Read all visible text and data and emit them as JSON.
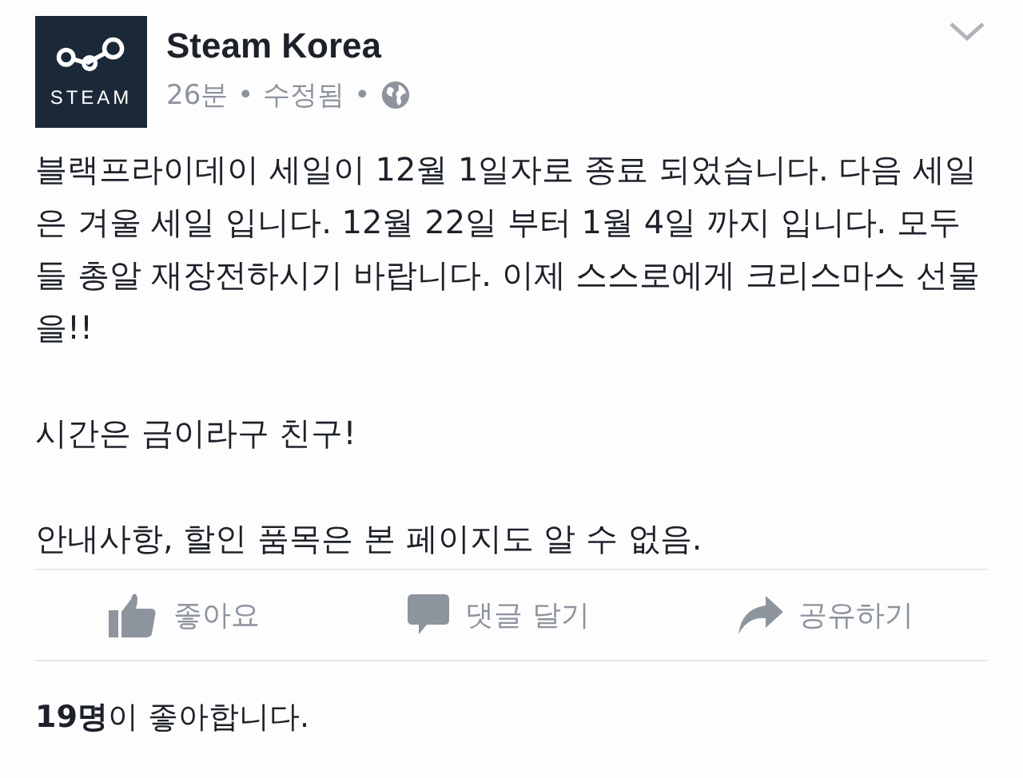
{
  "post": {
    "author": "Steam Korea",
    "logo_text": "STEAM",
    "time": "26분",
    "edited": "수정됨",
    "separator": "•",
    "paragraphs": [
      "블랙프라이데이 세일이 12월 1일자로 종료 되었습니다. 다음 세일은 겨울 세일 입니다. 12월 22일 부터 1월 4일 까지 입니다. 모두들 총알 재장전하시기 바랍니다. 이제 스스로에게 크리스마스 선물을!!",
      "시간은 금이라구 친구!",
      "안내사항, 할인 품목은 본 페이지도 알 수 없음."
    ],
    "actions": [
      {
        "kind": "like",
        "label": "좋아요"
      },
      {
        "kind": "comment",
        "label": "댓글 달기"
      },
      {
        "kind": "share",
        "label": "공유하기"
      }
    ],
    "likes": "**19명**이 좋아합니다."
  }
}
